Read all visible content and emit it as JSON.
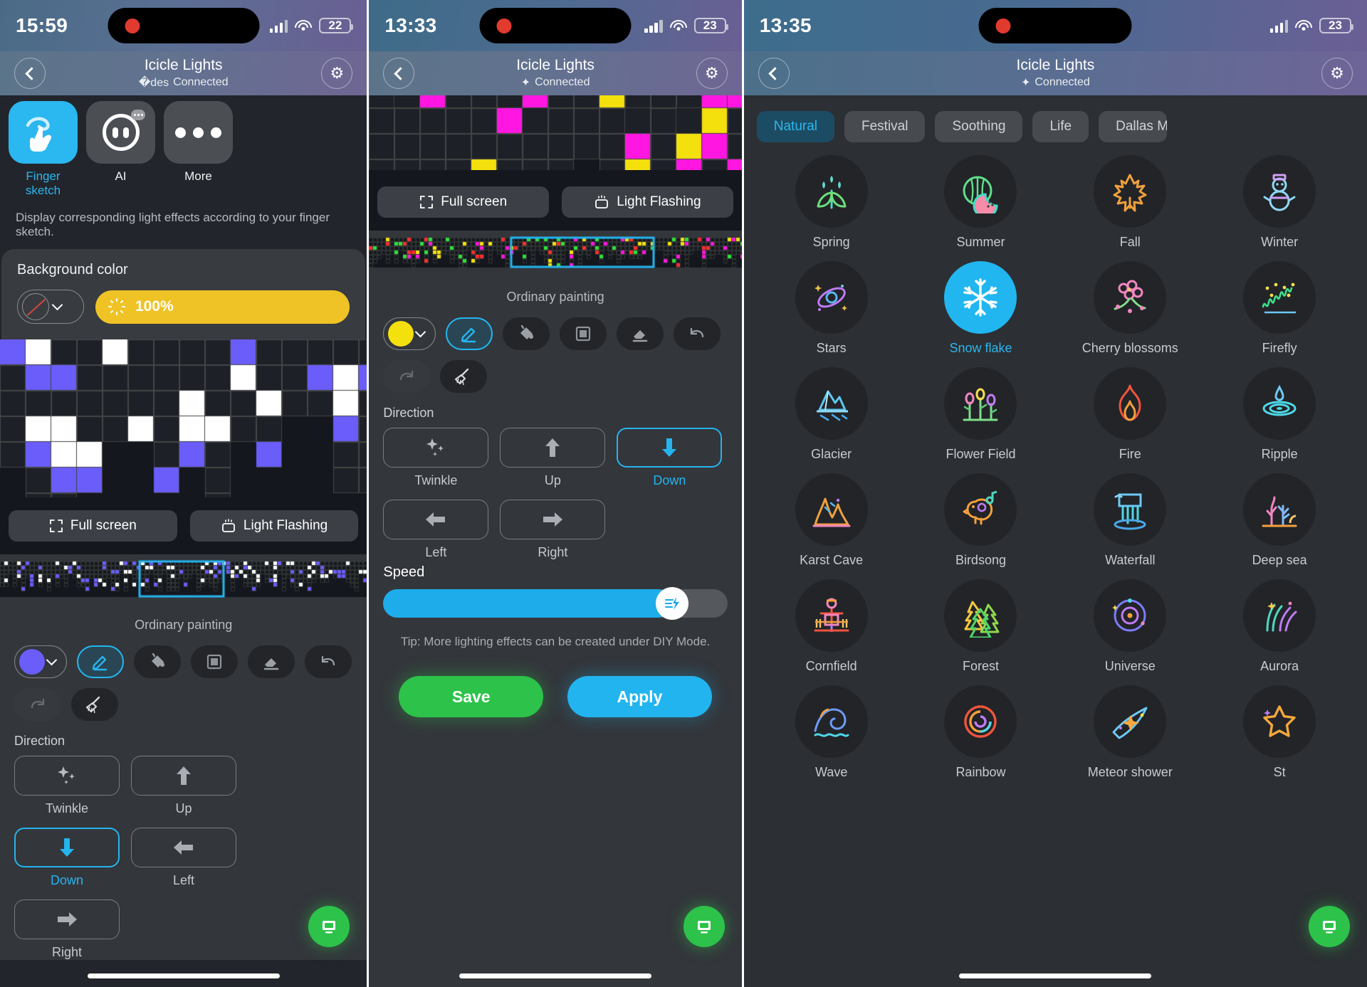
{
  "panels": [
    {
      "status": {
        "time": "15:59",
        "battery": "22"
      },
      "nav": {
        "title": "Icicle Lights",
        "subtitle": "Connected",
        "back_icon": "chevron-left-icon",
        "gear_icon": "gear-icon"
      },
      "modes": [
        {
          "label": "Finger sketch",
          "icon": "finger-sketch-icon",
          "active": true
        },
        {
          "label": "AI",
          "icon": "ai-robot-icon",
          "active": false
        },
        {
          "label": "More",
          "icon": "more-dots-icon",
          "active": false
        }
      ],
      "description": "Display corresponding light effects according to your finger sketch.",
      "background_color": {
        "title": "Background color",
        "swatch": "none",
        "brightness": "100%",
        "brightness_color": "#efc326"
      },
      "preview_buttons": [
        {
          "label": "Full screen",
          "icon": "fullscreen-icon"
        },
        {
          "label": "Light Flashing",
          "icon": "light-flashing-icon"
        }
      ],
      "paint": {
        "caption": "Ordinary painting",
        "current_color": "#6a5df9",
        "tools": [
          {
            "name": "color-picker",
            "selected": false
          },
          {
            "name": "pencil-tool",
            "selected": true
          },
          {
            "name": "fill-bucket-tool",
            "selected": false
          },
          {
            "name": "rectangle-tool",
            "selected": false
          },
          {
            "name": "eraser-tool",
            "selected": false
          },
          {
            "name": "undo-tool",
            "selected": false
          },
          {
            "name": "redo-tool",
            "selected": false,
            "disabled": true
          },
          {
            "name": "clear-broom-tool",
            "selected": false
          }
        ]
      },
      "direction": {
        "label": "Direction",
        "options": [
          {
            "label": "Twinkle",
            "icon": "sparkle-icon",
            "selected": false
          },
          {
            "label": "Up",
            "icon": "arrow-up-icon",
            "selected": false
          },
          {
            "label": "Down",
            "icon": "arrow-down-icon",
            "selected": true
          },
          {
            "label": "Left",
            "icon": "arrow-left-icon",
            "selected": false
          },
          {
            "label": "Right",
            "icon": "arrow-right-icon",
            "selected": false
          }
        ]
      },
      "fab": {
        "icon": "device-icon",
        "color": "#2dc24a"
      }
    },
    {
      "status": {
        "time": "13:33",
        "battery": "23"
      },
      "nav": {
        "title": "Icicle Lights",
        "subtitle": "Connected",
        "back_icon": "chevron-left-icon",
        "gear_icon": "gear-icon"
      },
      "preview_buttons": [
        {
          "label": "Full screen",
          "icon": "fullscreen-icon"
        },
        {
          "label": "Light Flashing",
          "icon": "light-flashing-icon"
        }
      ],
      "paint": {
        "caption": "Ordinary painting",
        "current_color": "#f4e00c",
        "tools": [
          {
            "name": "color-picker",
            "selected": false
          },
          {
            "name": "pencil-tool",
            "selected": true
          },
          {
            "name": "fill-bucket-tool",
            "selected": false
          },
          {
            "name": "rectangle-tool",
            "selected": false
          },
          {
            "name": "eraser-tool",
            "selected": false
          },
          {
            "name": "undo-tool",
            "selected": false
          },
          {
            "name": "redo-tool",
            "selected": false,
            "disabled": true
          },
          {
            "name": "clear-broom-tool",
            "selected": false
          }
        ]
      },
      "direction": {
        "label": "Direction",
        "options": [
          {
            "label": "Twinkle",
            "icon": "sparkle-icon",
            "selected": false
          },
          {
            "label": "Up",
            "icon": "arrow-up-icon",
            "selected": false
          },
          {
            "label": "Down",
            "icon": "arrow-down-icon",
            "selected": true
          },
          {
            "label": "Left",
            "icon": "arrow-left-icon",
            "selected": false
          },
          {
            "label": "Right",
            "icon": "arrow-right-icon",
            "selected": false
          }
        ]
      },
      "speed": {
        "label": "Speed",
        "value": 84,
        "knob_icon": "speed-bolt-icon"
      },
      "tip": "Tip: More lighting effects can be created under DIY Mode.",
      "actions": [
        {
          "label": "Save",
          "color": "#2dc24a"
        },
        {
          "label": "Apply",
          "color": "#22b4ef"
        }
      ],
      "fab": {
        "icon": "device-icon",
        "color": "#2dc24a"
      }
    },
    {
      "status": {
        "time": "13:35",
        "battery": "23"
      },
      "nav": {
        "title": "Icicle Lights",
        "subtitle": "Connected",
        "back_icon": "chevron-left-icon",
        "gear_icon": "gear-icon"
      },
      "tabs": [
        {
          "label": "Natural",
          "active": true
        },
        {
          "label": "Festival",
          "active": false
        },
        {
          "label": "Soothing",
          "active": false
        },
        {
          "label": "Life",
          "active": false
        },
        {
          "label": "Dallas Ma",
          "active": false,
          "truncated": true
        }
      ],
      "effects": [
        {
          "label": "Spring",
          "icon": "sprout-icon",
          "selected": false
        },
        {
          "label": "Summer",
          "icon": "watermelon-icon",
          "selected": false
        },
        {
          "label": "Fall",
          "icon": "maple-leaf-icon",
          "selected": false
        },
        {
          "label": "Winter",
          "icon": "snowman-icon",
          "selected": false
        },
        {
          "label": "Stars",
          "icon": "galaxy-icon",
          "selected": false
        },
        {
          "label": "Snow flake",
          "icon": "snowflake-icon",
          "selected": true
        },
        {
          "label": "Cherry blossoms",
          "icon": "cherry-blossom-icon",
          "selected": false
        },
        {
          "label": "Firefly",
          "icon": "firefly-icon",
          "selected": false
        },
        {
          "label": "Glacier",
          "icon": "glacier-icon",
          "selected": false
        },
        {
          "label": "Flower Field",
          "icon": "flower-field-icon",
          "selected": false
        },
        {
          "label": "Fire",
          "icon": "fire-icon",
          "selected": false
        },
        {
          "label": "Ripple",
          "icon": "ripple-icon",
          "selected": false
        },
        {
          "label": "Karst Cave",
          "icon": "karst-cave-icon",
          "selected": false
        },
        {
          "label": "Birdsong",
          "icon": "bird-icon",
          "selected": false
        },
        {
          "label": "Waterfall",
          "icon": "waterfall-icon",
          "selected": false
        },
        {
          "label": "Deep sea",
          "icon": "coral-icon",
          "selected": false
        },
        {
          "label": "Cornfield",
          "icon": "scarecrow-icon",
          "selected": false
        },
        {
          "label": "Forest",
          "icon": "pine-trees-icon",
          "selected": false
        },
        {
          "label": "Universe",
          "icon": "universe-icon",
          "selected": false
        },
        {
          "label": "Aurora",
          "icon": "aurora-icon",
          "selected": false
        },
        {
          "label": "Wave",
          "icon": "wave-icon",
          "selected": false
        },
        {
          "label": "Rainbow",
          "icon": "rainbow-swirl-icon",
          "selected": false
        },
        {
          "label": "Meteor shower",
          "icon": "meteor-icon",
          "selected": false
        },
        {
          "label": "St",
          "icon": "star-icon",
          "selected": false,
          "truncated": true
        }
      ],
      "fab": {
        "icon": "device-icon",
        "color": "#2dc24a"
      }
    }
  ]
}
